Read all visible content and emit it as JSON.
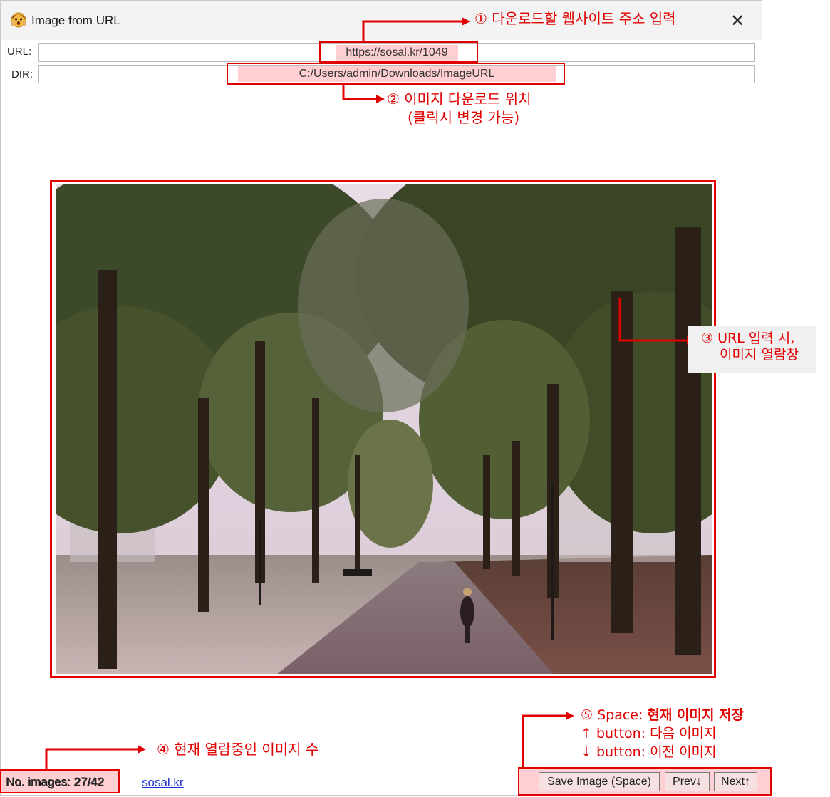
{
  "window": {
    "title": "Image from URL",
    "close_glyph": "✕"
  },
  "fields": {
    "url_label": "URL:",
    "url_value": "https://sosal.kr/1049",
    "dir_label": "DIR:",
    "dir_value": "C:/Users/admin/Downloads/ImageURL"
  },
  "footer": {
    "count_text": "No. images: 27/42",
    "link_text": "sosal.kr",
    "save_label": "Save Image (Space)",
    "prev_label": "Prev↓",
    "next_label": "Next↑"
  },
  "annotations": {
    "a1": "① 다운로드할 웹사이트 주소 입력",
    "a2_line1": "② 이미지 다운로드 위치",
    "a2_line2": "(클릭시 변경 가능)",
    "a3_line1": "③ URL 입력 시,",
    "a3_line2": "이미지 열람창",
    "a4": "④ 현재 열람중인 이미지 수",
    "a5_prefix": "⑤ Space: ",
    "a5_bold": "현재 이미지 저장",
    "a5_line2": "↑ button: 다음 이미지",
    "a5_line3": "↓ button: 이전 이미지"
  },
  "colors": {
    "annotation_red": "#e00000",
    "highlight_pink": "#ffcfd4",
    "link_blue": "#1a33cc"
  },
  "icons": [
    "app-face-icon",
    "close-icon",
    "arrow-icon"
  ]
}
